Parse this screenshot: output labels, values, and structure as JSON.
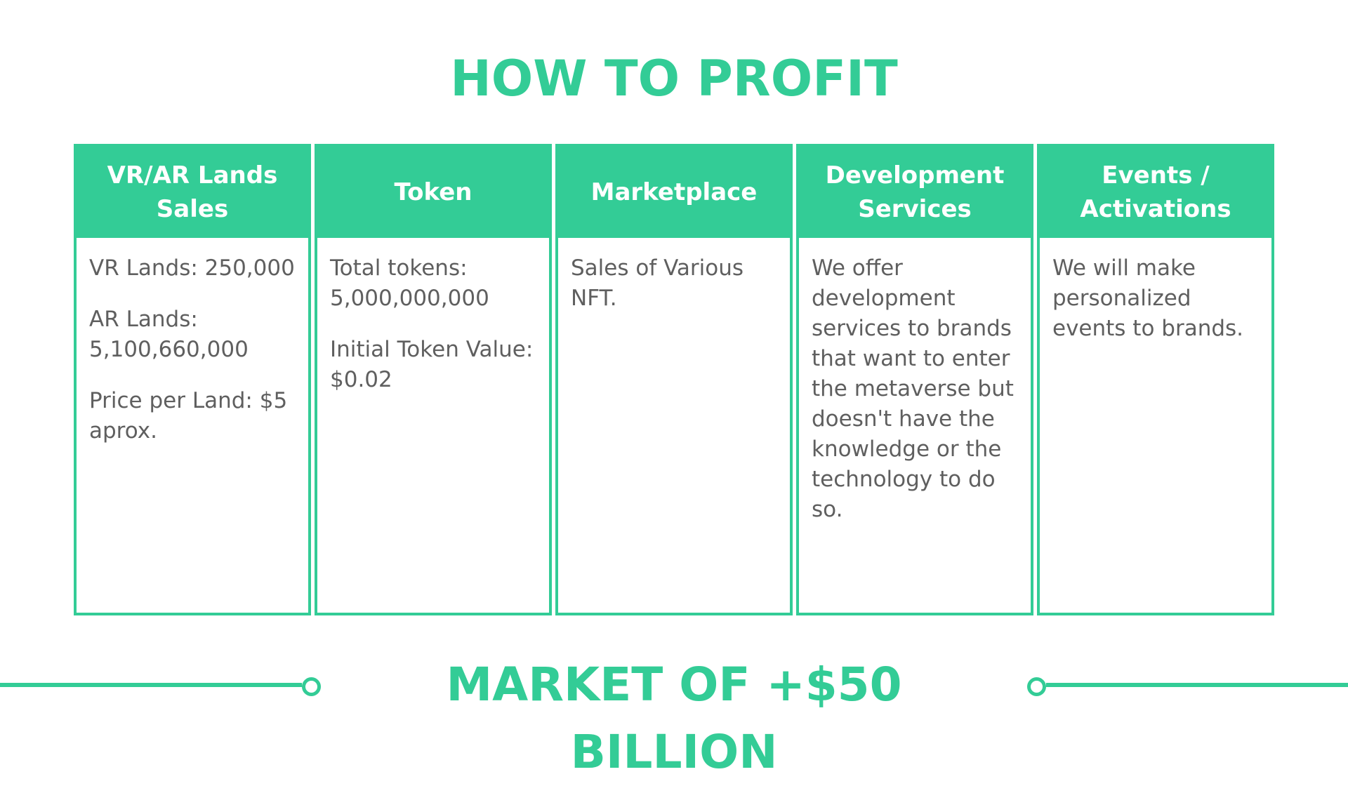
{
  "title": "HOW TO PROFIT",
  "columns": [
    {
      "header": [
        "VR/AR Lands",
        "Sales"
      ],
      "body": [
        "VR Lands: 250,000",
        "AR Lands: 5,100,660,000",
        "Price per Land: $5 aprox."
      ]
    },
    {
      "header": [
        "Token"
      ],
      "body": [
        "Total tokens: 5,000,000,000",
        "Initial Token Value: $0.02"
      ]
    },
    {
      "header": [
        "Marketplace"
      ],
      "body": [
        "Sales of Various NFT."
      ]
    },
    {
      "header": [
        "Development",
        "Services"
      ],
      "body": [
        "We offer development services to brands that want to enter the metaverse but doesn't have the knowledge or the technology to do so."
      ]
    },
    {
      "header": [
        "Events /",
        "Activations"
      ],
      "body": [
        "We will make personalized events to brands."
      ]
    }
  ],
  "footer": {
    "text": "MARKET OF +$50 BILLION"
  },
  "colors": {
    "accent": "#33cc96",
    "body_text": "#5f5f5f",
    "background": "#ffffff"
  }
}
